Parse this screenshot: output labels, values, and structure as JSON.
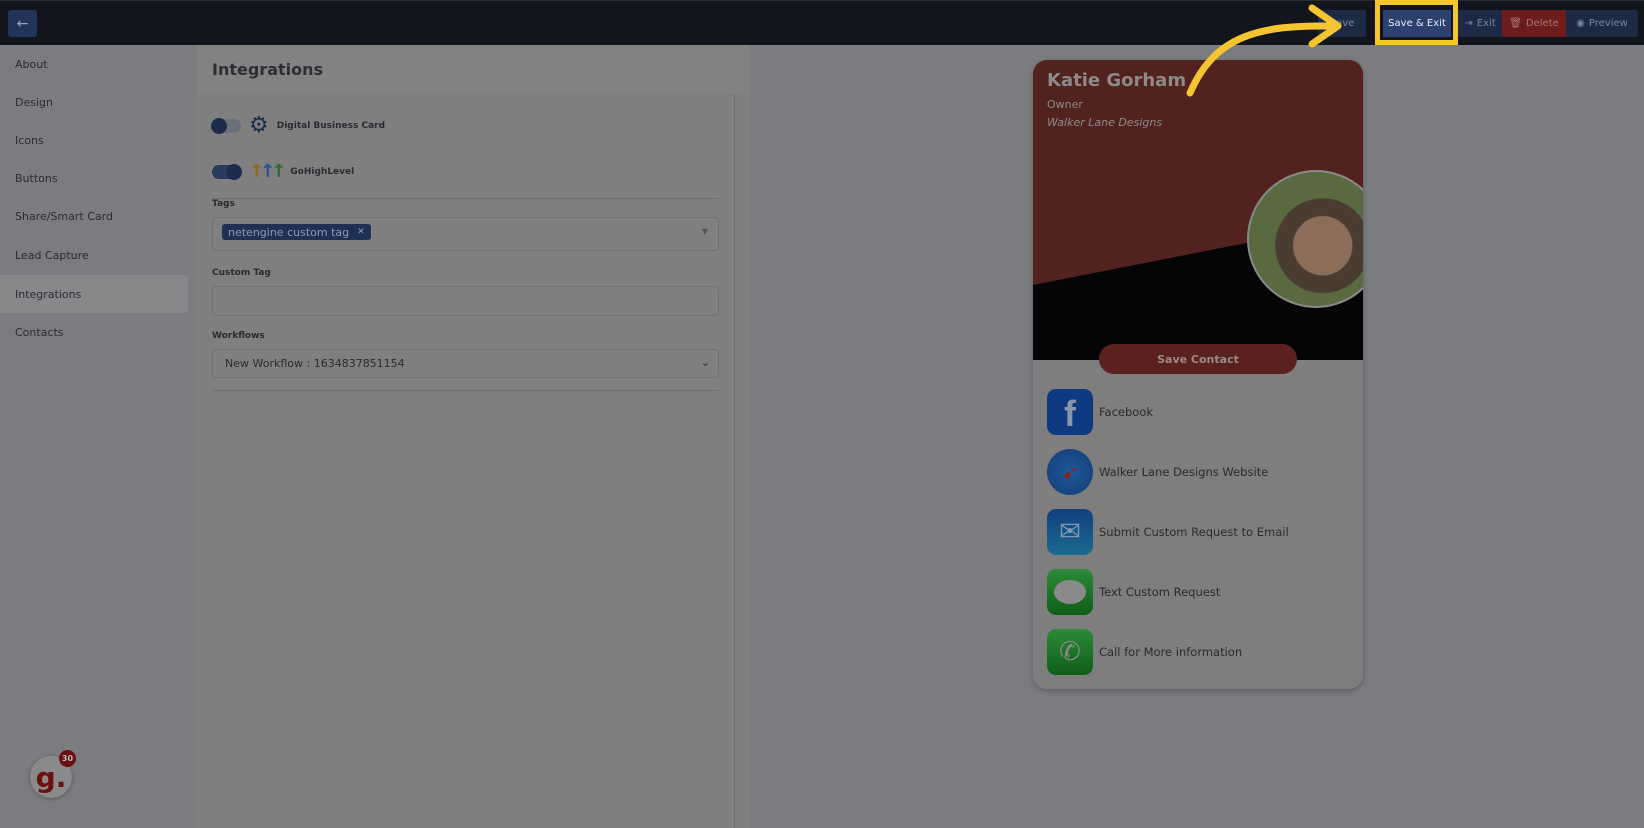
{
  "toolbar": {
    "back_icon": "arrow-left-icon",
    "save": "Save",
    "save_exit": "Save & Exit",
    "exit": "Exit",
    "delete": "Delete",
    "preview": "Preview",
    "highlight_color": "#f5c431"
  },
  "sidebar": {
    "items": [
      {
        "label": "About"
      },
      {
        "label": "Design"
      },
      {
        "label": "Icons"
      },
      {
        "label": "Buttons"
      },
      {
        "label": "Share/Smart Card"
      },
      {
        "label": "Lead Capture"
      },
      {
        "label": "Integrations",
        "active": true
      },
      {
        "label": "Contacts"
      }
    ]
  },
  "main": {
    "title": "Integrations",
    "integrations": [
      {
        "label": "Digital Business Card",
        "enabled": false
      },
      {
        "label": "GoHighLevel",
        "enabled": true
      }
    ],
    "tags_label": "Tags",
    "tags": [
      "netengine custom tag"
    ],
    "custom_tag_label": "Custom Tag",
    "custom_tag_value": "",
    "workflows_label": "Workflows",
    "workflow_selected": "New Workflow : 1634837851154"
  },
  "card": {
    "name": "Katie Gorham",
    "role": "Owner",
    "company": "Walker Lane Designs",
    "save_contact": "Save Contact",
    "accent": "#5a211e",
    "links": [
      {
        "label": "Facebook",
        "icon": "facebook-icon"
      },
      {
        "label": "Walker Lane Designs Website",
        "icon": "safari-compass-icon"
      },
      {
        "label": "Submit Custom Request to Email",
        "icon": "mail-icon"
      },
      {
        "label": "Text Custom Request",
        "icon": "message-bubble-icon"
      },
      {
        "label": "Call for More information",
        "icon": "phone-icon"
      }
    ]
  },
  "widget": {
    "letter": "g.",
    "count": "30"
  }
}
